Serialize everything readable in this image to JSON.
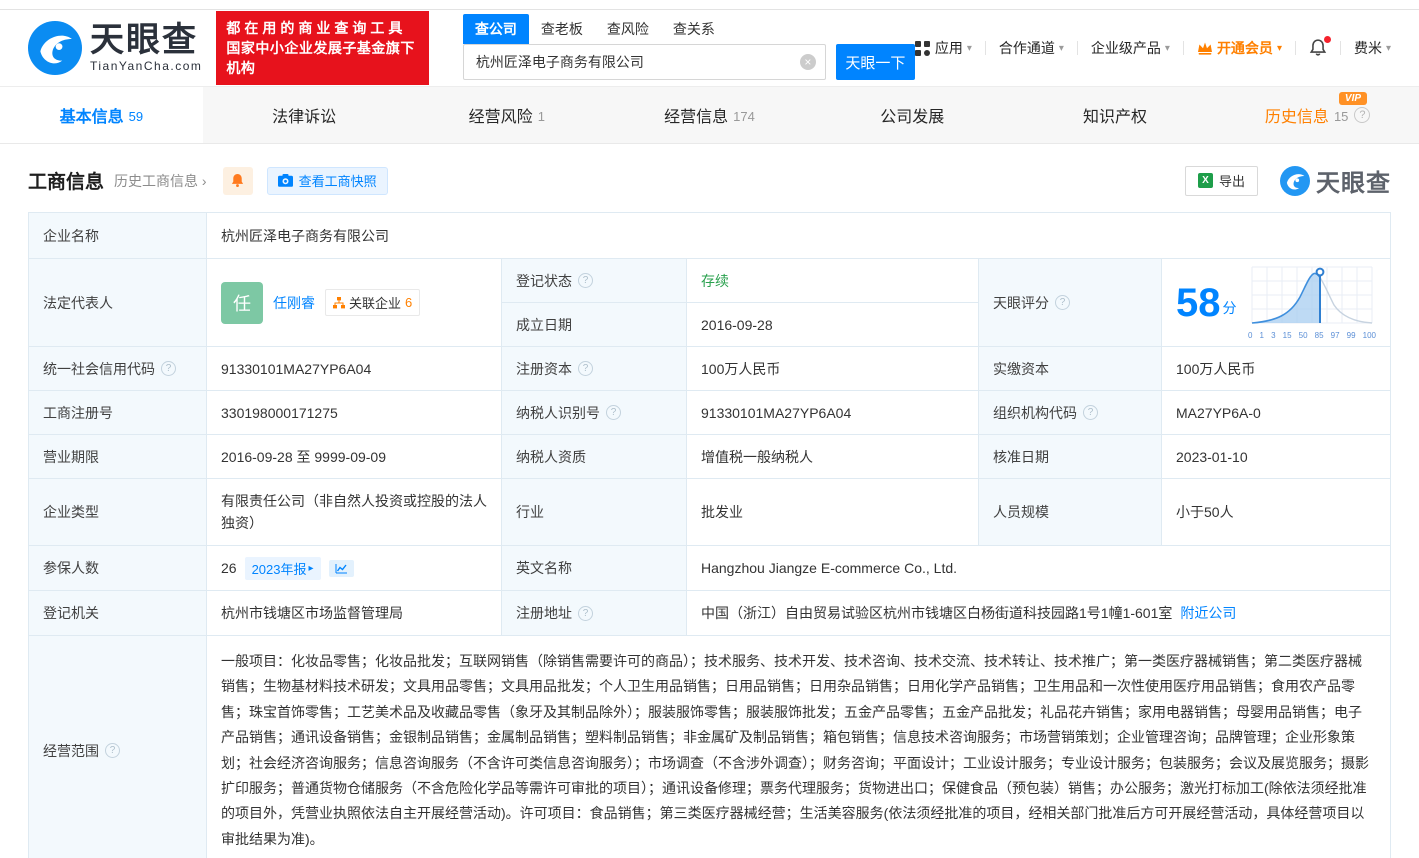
{
  "colors": {
    "brand_blue": "#0084ff",
    "orange": "#ff8000",
    "green": "#2aa14e",
    "red": "#e7121c"
  },
  "icons": {
    "help": "?",
    "caret": "▾",
    "chevron": "›",
    "arrow_right": "▸",
    "clear": "×",
    "vip": "VIP",
    "excel_x": "X"
  },
  "header": {
    "logo": {
      "title": "天眼查",
      "domain": "TianYanCha.com"
    },
    "slogan": {
      "line1": "都在用的商业查询工具",
      "line2": "国家中小企业发展子基金旗下机构"
    },
    "search": {
      "tabs": [
        {
          "label": "查公司"
        },
        {
          "label": "查老板"
        },
        {
          "label": "查风险"
        },
        {
          "label": "查关系"
        }
      ],
      "value": "杭州匠泽电子商务有限公司",
      "button": "天眼一下"
    },
    "nav": {
      "apps": "应用",
      "partner": "合作通道",
      "enterprise": "企业级产品",
      "vip": "开通会员",
      "user": "费米"
    }
  },
  "tabs": [
    {
      "label": "基本信息",
      "count": "59"
    },
    {
      "label": "法律诉讼",
      "count": ""
    },
    {
      "label": "经营风险",
      "count": "1"
    },
    {
      "label": "经营信息",
      "count": "174"
    },
    {
      "label": "公司发展",
      "count": ""
    },
    {
      "label": "知识产权",
      "count": ""
    },
    {
      "label": "历史信息",
      "count": "15"
    }
  ],
  "toolbar": {
    "title": "工商信息",
    "history_link": "历史工商信息",
    "snapshot": "查看工商快照",
    "export": "导出",
    "watermark": "天眼查"
  },
  "fields": {
    "company_name": {
      "label": "企业名称",
      "value": "杭州匠泽电子商务有限公司"
    },
    "legal_rep": {
      "label": "法定代表人",
      "avatar": "任",
      "name": "任刚睿",
      "related_label": "关联企业",
      "related_count": "6"
    },
    "reg_status": {
      "label": "登记状态",
      "value": "存续"
    },
    "establish_date": {
      "label": "成立日期",
      "value": "2016-09-28"
    },
    "score": {
      "label": "天眼评分",
      "value": "58",
      "unit": "分",
      "axis": [
        "0",
        "1",
        "3",
        "15",
        "50",
        "85",
        "97",
        "99",
        "100"
      ]
    },
    "credit_code": {
      "label": "统一社会信用代码",
      "value": "91330101MA27YP6A04"
    },
    "reg_capital": {
      "label": "注册资本",
      "value": "100万人民币"
    },
    "paid_capital": {
      "label": "实缴资本",
      "value": "100万人民币"
    },
    "reg_number": {
      "label": "工商注册号",
      "value": "330198000171275"
    },
    "taxpayer_id": {
      "label": "纳税人识别号",
      "value": "91330101MA27YP6A04"
    },
    "org_code": {
      "label": "组织机构代码",
      "value": "MA27YP6A-0"
    },
    "business_term": {
      "label": "营业期限",
      "value": "2016-09-28 至 9999-09-09"
    },
    "taxpayer_quality": {
      "label": "纳税人资质",
      "value": "增值税一般纳税人"
    },
    "approval_date": {
      "label": "核准日期",
      "value": "2023-01-10"
    },
    "company_type": {
      "label": "企业类型",
      "value": "有限责任公司（非自然人投资或控股的法人独资）"
    },
    "industry": {
      "label": "行业",
      "value": "批发业"
    },
    "staff_size": {
      "label": "人员规模",
      "value": "小于50人"
    },
    "insured": {
      "label": "参保人数",
      "value": "26",
      "report_badge": "2023年报"
    },
    "english_name": {
      "label": "英文名称",
      "value": "Hangzhou Jiangze E-commerce Co., Ltd."
    },
    "reg_authority": {
      "label": "登记机关",
      "value": "杭州市钱塘区市场监督管理局"
    },
    "reg_address": {
      "label": "注册地址",
      "value": "中国（浙江）自由贸易试验区杭州市钱塘区白杨街道科技园路1号1幢1-601室",
      "nearby_link": "附近公司"
    },
    "business_scope": {
      "label": "经营范围",
      "value": "一般项目：化妆品零售；化妆品批发；互联网销售（除销售需要许可的商品）；技术服务、技术开发、技术咨询、技术交流、技术转让、技术推广；第一类医疗器械销售；第二类医疗器械销售；生物基材料技术研发；文具用品零售；文具用品批发；个人卫生用品销售；日用品销售；日用杂品销售；日用化学产品销售；卫生用品和一次性使用医疗用品销售；食用农产品零售；珠宝首饰零售；工艺美术品及收藏品零售（象牙及其制品除外）；服装服饰零售；服装服饰批发；五金产品零售；五金产品批发；礼品花卉销售；家用电器销售；母婴用品销售；电子产品销售；通讯设备销售；金银制品销售；金属制品销售；塑料制品销售；非金属矿及制品销售；箱包销售；信息技术咨询服务；市场营销策划；企业管理咨询；品牌管理；企业形象策划；社会经济咨询服务；信息咨询服务（不含许可类信息咨询服务）；市场调查（不含涉外调查）；财务咨询；平面设计；工业设计服务；专业设计服务；包装服务；会议及展览服务；摄影扩印服务；普通货物仓储服务（不含危险化学品等需许可审批的项目）；通讯设备修理；票务代理服务；货物进出口；保健食品（预包装）销售；办公服务；激光打标加工(除依法须经批准的项目外，凭营业执照依法自主开展经营活动)。许可项目：食品销售；第三类医疗器械经营；生活美容服务(依法须经批准的项目，经相关部门批准后方可开展经营活动，具体经营项目以审批结果为准)。"
    }
  }
}
